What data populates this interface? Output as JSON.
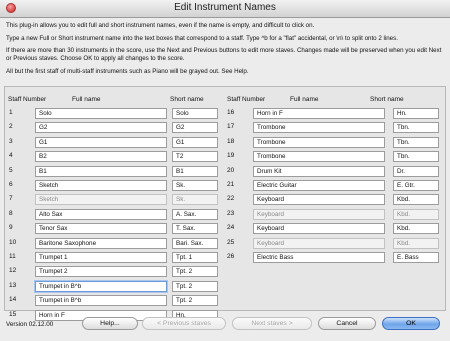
{
  "window": {
    "title": "Edit Instrument Names"
  },
  "intro": {
    "p1": "This plug-in allows you to edit full and short instrument names, even if the name is empty, and difficult to click on.",
    "p2": "Type a new Full or Short instrument name into the text boxes that correspond to a staff. Type ^b for a \"flat\" accidental, or \\n\\ to split onto 2 lines.",
    "p3": "If there are more than 30 instruments in the score, use the Next and Previous buttons to edit more staves. Changes made will be preserved when you edit Next or Previous staves.  Choose OK to apply all changes to the score.",
    "p4": "All but the first staff of multi-staff instruments such as Piano will be grayed out. See Help."
  },
  "headers": {
    "staff_number": "Staff Number",
    "full_name": "Full name",
    "short_name": "Short name"
  },
  "left_rows": [
    {
      "num": "1",
      "full": "Solo",
      "short": "Solo",
      "gray": false
    },
    {
      "num": "2",
      "full": "G2",
      "short": "G2",
      "gray": false
    },
    {
      "num": "3",
      "full": "G1",
      "short": "G1",
      "gray": false
    },
    {
      "num": "4",
      "full": "B2",
      "short": "T2",
      "gray": false
    },
    {
      "num": "5",
      "full": "B1",
      "short": "B1",
      "gray": false
    },
    {
      "num": "6",
      "full": "Sketch",
      "short": "Sk.",
      "gray": false
    },
    {
      "num": "7",
      "full": "Sketch",
      "short": "Sk.",
      "gray": true
    },
    {
      "num": "8",
      "full": "Alto Sax",
      "short": "A. Sax.",
      "gray": false
    },
    {
      "num": "9",
      "full": "Tenor Sax",
      "short": "T. Sax.",
      "gray": false
    },
    {
      "num": "10",
      "full": "Baritone Saxophone",
      "short": "Bari. Sax.",
      "gray": false
    },
    {
      "num": "11",
      "full": "Trumpet 1",
      "short": "Tpt. 1",
      "gray": false
    },
    {
      "num": "12",
      "full": "Trumpet 2",
      "short": "Tpt. 2",
      "gray": false
    },
    {
      "num": "13",
      "full": "Trumpet in B^b",
      "short": "Tpt. 2",
      "gray": false,
      "focused": true
    },
    {
      "num": "14",
      "full": "Trumpet in B^b",
      "short": "Tpt. 2",
      "gray": false
    },
    {
      "num": "15",
      "full": "Horn in F",
      "short": "Hn.",
      "gray": false
    }
  ],
  "right_rows": [
    {
      "num": "16",
      "full": "Horn in F",
      "short": "Hn.",
      "gray": false
    },
    {
      "num": "17",
      "full": "Trombone",
      "short": "Tbn.",
      "gray": false
    },
    {
      "num": "18",
      "full": "Trombone",
      "short": "Tbn.",
      "gray": false
    },
    {
      "num": "19",
      "full": "Trombone",
      "short": "Tbn.",
      "gray": false
    },
    {
      "num": "20",
      "full": "Drum Kit",
      "short": "Dr.",
      "gray": false
    },
    {
      "num": "21",
      "full": "Electric Guitar",
      "short": "E. Gtr.",
      "gray": false
    },
    {
      "num": "22",
      "full": "Keyboard",
      "short": "Kbd.",
      "gray": false
    },
    {
      "num": "23",
      "full": "Keyboard",
      "short": "Kbd.",
      "gray": true
    },
    {
      "num": "24",
      "full": "Keyboard",
      "short": "Kbd.",
      "gray": false
    },
    {
      "num": "25",
      "full": "Keyboard",
      "short": "Kbd.",
      "gray": true
    },
    {
      "num": "26",
      "full": "Electric Bass",
      "short": "E. Bass",
      "gray": false
    }
  ],
  "footer": {
    "version": "Version 02.12.00",
    "help": "Help...",
    "previous": "< Previous staves",
    "next": "Next staves >",
    "cancel": "Cancel",
    "ok": "OK"
  }
}
